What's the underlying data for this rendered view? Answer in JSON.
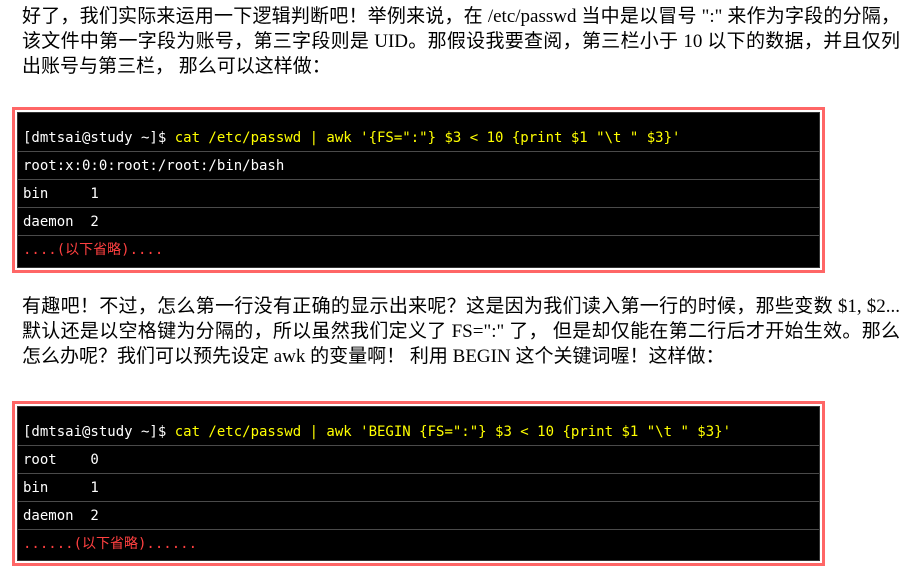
{
  "colors": {
    "terminal_bg": "#000000",
    "terminal_text": "#ffffff",
    "command_text": "#ffff00",
    "note_text": "#ff4040",
    "frame_border": "#ff6666"
  },
  "paragraph1": "好了，我们实际来运用一下逻辑判断吧！举例来说，在 /etc/passwd 当中是以冒号 \":\" 来作为字段的分隔， 该文件中第一字段为账号，第三字段则是 UID。那假设我要查阅，第三栏小于 10 以下的数据，并且仅列出账号与第三栏， 那么可以这样做：",
  "terminal1": {
    "prompt": "[dmtsai@study ~]$ ",
    "command": "cat /etc/passwd | awk '{FS=\":\"} $3 < 10 {print $1 \"\\t \" $3}'",
    "output": [
      "root:x:0:0:root:/root:/bin/bash",
      "bin     1",
      "daemon  2"
    ],
    "note": "....(以下省略)...."
  },
  "paragraph2": "有趣吧！不过，怎么第一行没有正确的显示出来呢？这是因为我们读入第一行的时候，那些变数 $1, $2... 默认还是以空格键为分隔的，所以虽然我们定义了 FS=\":\" 了， 但是却仅能在第二行后才开始生效。那么怎么办呢？我们可以预先设定 awk 的变量啊！ 利用 BEGIN 这个关键词喔！这样做：",
  "terminal2": {
    "prompt": "[dmtsai@study ~]$ ",
    "command": "cat /etc/passwd | awk 'BEGIN {FS=\":\"} $3 < 10 {print $1 \"\\t \" $3}'",
    "output": [
      "root    0",
      "bin     1",
      "daemon  2"
    ],
    "note": "......(以下省略)......"
  }
}
